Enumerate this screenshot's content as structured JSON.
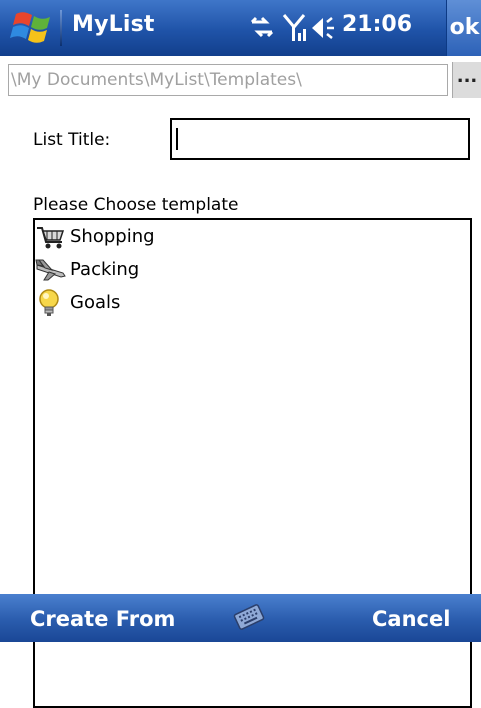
{
  "titlebar": {
    "app_title": "MyList",
    "clock": "21:06",
    "ok_label": "ok",
    "icons": [
      "windows-start-icon",
      "connectivity-icon",
      "signal-icon",
      "volume-icon"
    ]
  },
  "pathbar": {
    "path": "\\My Documents\\MyList\\Templates\\",
    "browse_label": "..."
  },
  "form": {
    "list_title_label": "List Title:",
    "list_title_value": "",
    "choose_label": "Please Choose template"
  },
  "templates": [
    {
      "label": "Shopping",
      "icon": "shopping-cart-icon"
    },
    {
      "label": "Packing",
      "icon": "airplane-icon"
    },
    {
      "label": "Goals",
      "icon": "lightbulb-icon"
    }
  ],
  "softkeys": {
    "left": "Create From",
    "right": "Cancel",
    "center_icon": "keyboard-icon"
  },
  "colors": {
    "titlebar": "#1f53a8",
    "softbar": "#2a5cad",
    "path_text": "#a0a0a0"
  }
}
